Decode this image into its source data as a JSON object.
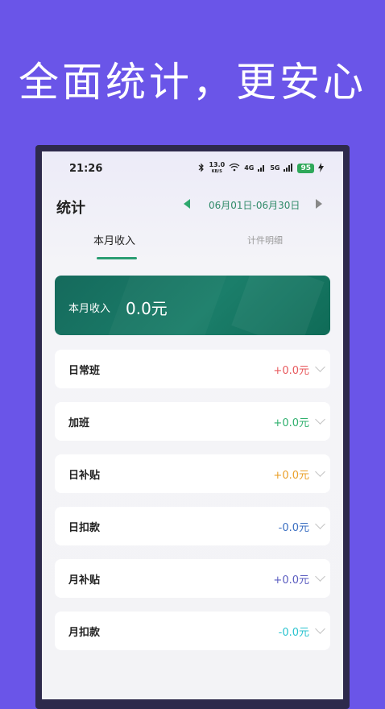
{
  "headline": "全面统计，更安心",
  "status": {
    "time": "21:26",
    "speed_top": "13.0",
    "speed_bottom": "KB/S",
    "net1": "4G",
    "net2": "5G",
    "battery": "95"
  },
  "header": {
    "title": "统计",
    "date_range": "06月01日-06月30日"
  },
  "tabs": [
    {
      "label": "本月收入",
      "active": true
    },
    {
      "label": "计件明细",
      "active": false
    }
  ],
  "summary": {
    "label": "本月收入",
    "value": "0.0元"
  },
  "rows": [
    {
      "label": "日常班",
      "value": "+0.0元",
      "color": "#e8595d"
    },
    {
      "label": "加班",
      "value": "+0.0元",
      "color": "#2fb06e"
    },
    {
      "label": "日补贴",
      "value": "+0.0元",
      "color": "#eaa02a"
    },
    {
      "label": "日扣款",
      "value": "-0.0元",
      "color": "#3b6fc2"
    },
    {
      "label": "月补贴",
      "value": "+0.0元",
      "color": "#5a5cc0"
    },
    {
      "label": "月扣款",
      "value": "-0.0元",
      "color": "#29c3cf"
    }
  ],
  "colors": {
    "background": "#6a55e8",
    "accent_green": "#2a9d72",
    "card_green": "#1b7e6a"
  }
}
